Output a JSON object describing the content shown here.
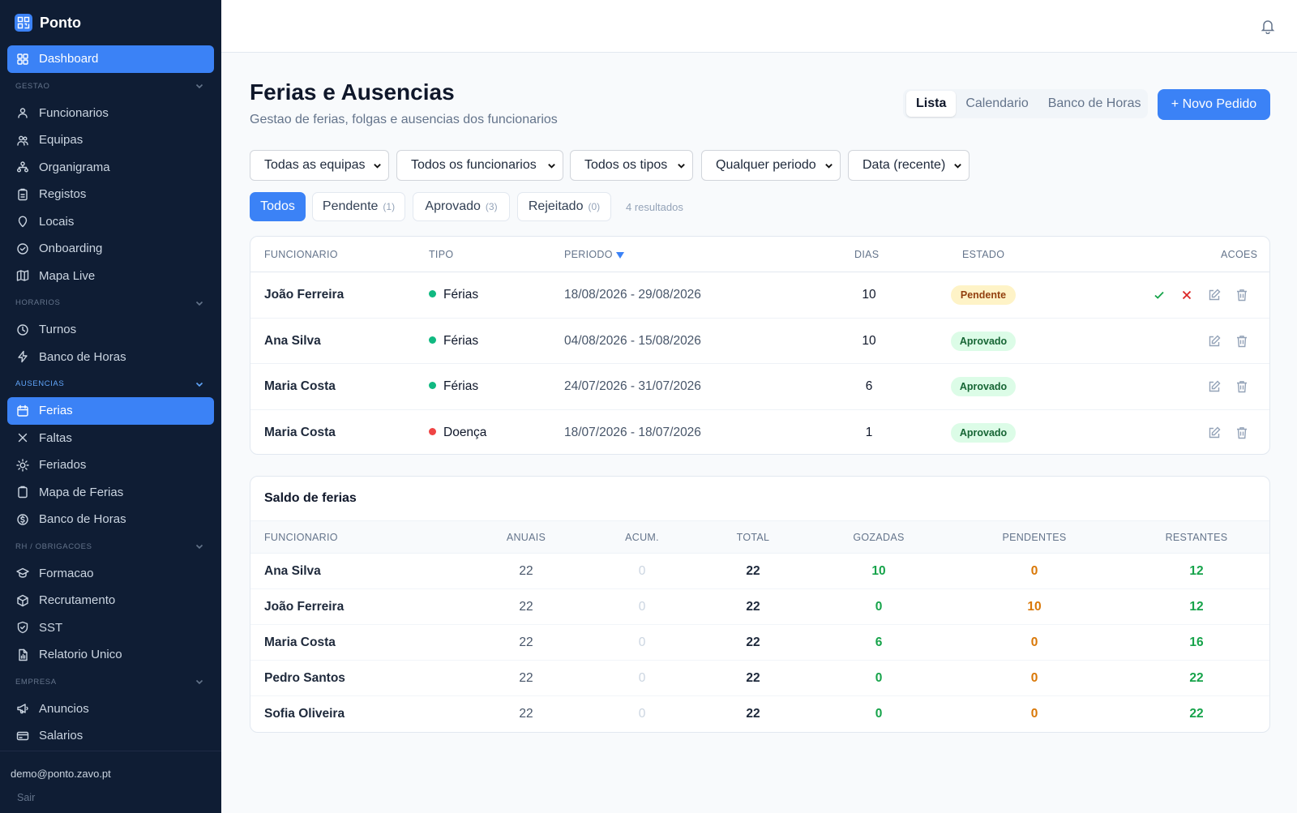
{
  "app": {
    "name": "Ponto"
  },
  "sidebar": {
    "dashboard": "Dashboard",
    "sections": [
      {
        "title": "GESTAO",
        "items": [
          "Funcionarios",
          "Equipas",
          "Organigrama",
          "Registos",
          "Locais",
          "Onboarding",
          "Mapa Live"
        ]
      },
      {
        "title": "HORARIOS",
        "items": [
          "Turnos",
          "Banco de Horas"
        ]
      },
      {
        "title": "AUSENCIAS",
        "items": [
          "Ferias",
          "Faltas",
          "Feriados",
          "Mapa de Ferias",
          "Banco de Horas"
        ]
      },
      {
        "title": "RH / OBRIGACOES",
        "items": [
          "Formacao",
          "Recrutamento",
          "SST",
          "Relatorio Unico"
        ]
      },
      {
        "title": "EMPRESA",
        "items": [
          "Anuncios",
          "Salarios"
        ]
      }
    ],
    "user_email": "demo@ponto.zavo.pt",
    "logout": "Sair"
  },
  "page": {
    "title": "Ferias e Ausencias",
    "subtitle": "Gestao de ferias, folgas e ausencias dos funcionarios",
    "view_tabs": [
      "Lista",
      "Calendario",
      "Banco de Horas"
    ],
    "new_button": "+ Novo Pedido"
  },
  "filters": [
    "Todas as equipas",
    "Todos os funcionarios",
    "Todos os tipos",
    "Qualquer periodo",
    "Data (recente)"
  ],
  "status_tabs": [
    {
      "label": "Todos",
      "count": ""
    },
    {
      "label": "Pendente",
      "count": "(1)"
    },
    {
      "label": "Aprovado",
      "count": "(3)"
    },
    {
      "label": "Rejeitado",
      "count": "(0)"
    }
  ],
  "results": "4 resultados",
  "requests": {
    "headers": [
      "FUNCIONARIO",
      "TIPO",
      "PERIODO",
      "DIAS",
      "ESTADO",
      "ACOES"
    ],
    "rows": [
      {
        "name": "João Ferreira",
        "type": "Férias",
        "type_color": "#10b981",
        "period": "18/08/2026 - 29/08/2026",
        "days": "10",
        "status": "Pendente"
      },
      {
        "name": "Ana Silva",
        "type": "Férias",
        "type_color": "#10b981",
        "period": "04/08/2026 - 15/08/2026",
        "days": "10",
        "status": "Aprovado"
      },
      {
        "name": "Maria Costa",
        "type": "Férias",
        "type_color": "#10b981",
        "period": "24/07/2026 - 31/07/2026",
        "days": "6",
        "status": "Aprovado"
      },
      {
        "name": "Maria Costa",
        "type": "Doença",
        "type_color": "#ef4444",
        "period": "18/07/2026 - 18/07/2026",
        "days": "1",
        "status": "Aprovado"
      }
    ]
  },
  "balance": {
    "title": "Saldo de ferias",
    "headers": [
      "FUNCIONARIO",
      "ANUAIS",
      "ACUM.",
      "TOTAL",
      "GOZADAS",
      "PENDENTES",
      "RESTANTES"
    ],
    "rows": [
      {
        "name": "Ana Silva",
        "anuais": "22",
        "acum": "0",
        "total": "22",
        "gozadas": "10",
        "pendentes": "0",
        "restantes": "12"
      },
      {
        "name": "João Ferreira",
        "anuais": "22",
        "acum": "0",
        "total": "22",
        "gozadas": "0",
        "pendentes": "10",
        "restantes": "12"
      },
      {
        "name": "Maria Costa",
        "anuais": "22",
        "acum": "0",
        "total": "22",
        "gozadas": "6",
        "pendentes": "0",
        "restantes": "16"
      },
      {
        "name": "Pedro Santos",
        "anuais": "22",
        "acum": "0",
        "total": "22",
        "gozadas": "0",
        "pendentes": "0",
        "restantes": "22"
      },
      {
        "name": "Sofia Oliveira",
        "anuais": "22",
        "acum": "0",
        "total": "22",
        "gozadas": "0",
        "pendentes": "0",
        "restantes": "22"
      }
    ]
  },
  "colors": {
    "accent": "#3b82f6",
    "sidebar": "#0f1d34",
    "pending_bg": "#fef3c7",
    "pending_fg": "#92400e",
    "approved_bg": "#dcfce7",
    "approved_fg": "#166534"
  }
}
